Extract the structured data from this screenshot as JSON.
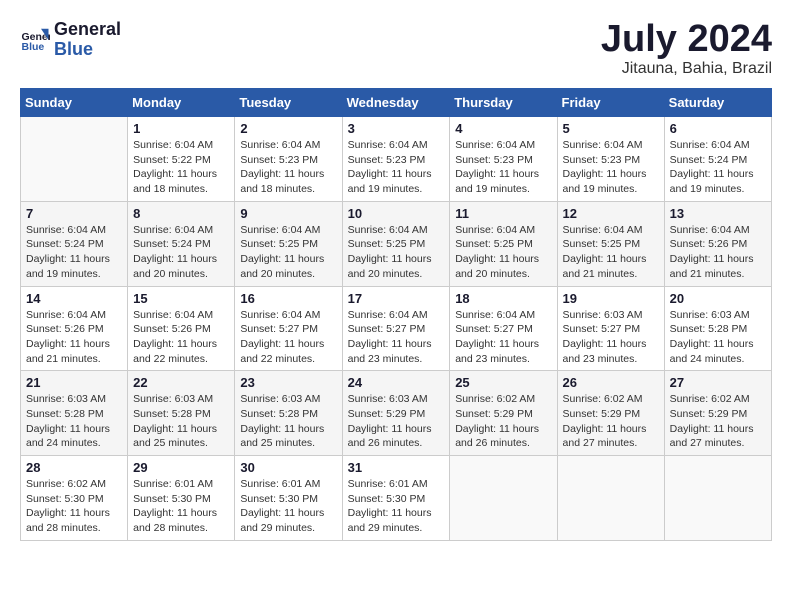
{
  "header": {
    "logo_line1": "General",
    "logo_line2": "Blue",
    "month_title": "July 2024",
    "subtitle": "Jitauna, Bahia, Brazil"
  },
  "days_of_week": [
    "Sunday",
    "Monday",
    "Tuesday",
    "Wednesday",
    "Thursday",
    "Friday",
    "Saturday"
  ],
  "weeks": [
    [
      {
        "day": "",
        "info": ""
      },
      {
        "day": "1",
        "info": "Sunrise: 6:04 AM\nSunset: 5:22 PM\nDaylight: 11 hours\nand 18 minutes."
      },
      {
        "day": "2",
        "info": "Sunrise: 6:04 AM\nSunset: 5:23 PM\nDaylight: 11 hours\nand 18 minutes."
      },
      {
        "day": "3",
        "info": "Sunrise: 6:04 AM\nSunset: 5:23 PM\nDaylight: 11 hours\nand 19 minutes."
      },
      {
        "day": "4",
        "info": "Sunrise: 6:04 AM\nSunset: 5:23 PM\nDaylight: 11 hours\nand 19 minutes."
      },
      {
        "day": "5",
        "info": "Sunrise: 6:04 AM\nSunset: 5:23 PM\nDaylight: 11 hours\nand 19 minutes."
      },
      {
        "day": "6",
        "info": "Sunrise: 6:04 AM\nSunset: 5:24 PM\nDaylight: 11 hours\nand 19 minutes."
      }
    ],
    [
      {
        "day": "7",
        "info": "Sunrise: 6:04 AM\nSunset: 5:24 PM\nDaylight: 11 hours\nand 19 minutes."
      },
      {
        "day": "8",
        "info": "Sunrise: 6:04 AM\nSunset: 5:24 PM\nDaylight: 11 hours\nand 20 minutes."
      },
      {
        "day": "9",
        "info": "Sunrise: 6:04 AM\nSunset: 5:25 PM\nDaylight: 11 hours\nand 20 minutes."
      },
      {
        "day": "10",
        "info": "Sunrise: 6:04 AM\nSunset: 5:25 PM\nDaylight: 11 hours\nand 20 minutes."
      },
      {
        "day": "11",
        "info": "Sunrise: 6:04 AM\nSunset: 5:25 PM\nDaylight: 11 hours\nand 20 minutes."
      },
      {
        "day": "12",
        "info": "Sunrise: 6:04 AM\nSunset: 5:25 PM\nDaylight: 11 hours\nand 21 minutes."
      },
      {
        "day": "13",
        "info": "Sunrise: 6:04 AM\nSunset: 5:26 PM\nDaylight: 11 hours\nand 21 minutes."
      }
    ],
    [
      {
        "day": "14",
        "info": "Sunrise: 6:04 AM\nSunset: 5:26 PM\nDaylight: 11 hours\nand 21 minutes."
      },
      {
        "day": "15",
        "info": "Sunrise: 6:04 AM\nSunset: 5:26 PM\nDaylight: 11 hours\nand 22 minutes."
      },
      {
        "day": "16",
        "info": "Sunrise: 6:04 AM\nSunset: 5:27 PM\nDaylight: 11 hours\nand 22 minutes."
      },
      {
        "day": "17",
        "info": "Sunrise: 6:04 AM\nSunset: 5:27 PM\nDaylight: 11 hours\nand 23 minutes."
      },
      {
        "day": "18",
        "info": "Sunrise: 6:04 AM\nSunset: 5:27 PM\nDaylight: 11 hours\nand 23 minutes."
      },
      {
        "day": "19",
        "info": "Sunrise: 6:03 AM\nSunset: 5:27 PM\nDaylight: 11 hours\nand 23 minutes."
      },
      {
        "day": "20",
        "info": "Sunrise: 6:03 AM\nSunset: 5:28 PM\nDaylight: 11 hours\nand 24 minutes."
      }
    ],
    [
      {
        "day": "21",
        "info": "Sunrise: 6:03 AM\nSunset: 5:28 PM\nDaylight: 11 hours\nand 24 minutes."
      },
      {
        "day": "22",
        "info": "Sunrise: 6:03 AM\nSunset: 5:28 PM\nDaylight: 11 hours\nand 25 minutes."
      },
      {
        "day": "23",
        "info": "Sunrise: 6:03 AM\nSunset: 5:28 PM\nDaylight: 11 hours\nand 25 minutes."
      },
      {
        "day": "24",
        "info": "Sunrise: 6:03 AM\nSunset: 5:29 PM\nDaylight: 11 hours\nand 26 minutes."
      },
      {
        "day": "25",
        "info": "Sunrise: 6:02 AM\nSunset: 5:29 PM\nDaylight: 11 hours\nand 26 minutes."
      },
      {
        "day": "26",
        "info": "Sunrise: 6:02 AM\nSunset: 5:29 PM\nDaylight: 11 hours\nand 27 minutes."
      },
      {
        "day": "27",
        "info": "Sunrise: 6:02 AM\nSunset: 5:29 PM\nDaylight: 11 hours\nand 27 minutes."
      }
    ],
    [
      {
        "day": "28",
        "info": "Sunrise: 6:02 AM\nSunset: 5:30 PM\nDaylight: 11 hours\nand 28 minutes."
      },
      {
        "day": "29",
        "info": "Sunrise: 6:01 AM\nSunset: 5:30 PM\nDaylight: 11 hours\nand 28 minutes."
      },
      {
        "day": "30",
        "info": "Sunrise: 6:01 AM\nSunset: 5:30 PM\nDaylight: 11 hours\nand 29 minutes."
      },
      {
        "day": "31",
        "info": "Sunrise: 6:01 AM\nSunset: 5:30 PM\nDaylight: 11 hours\nand 29 minutes."
      },
      {
        "day": "",
        "info": ""
      },
      {
        "day": "",
        "info": ""
      },
      {
        "day": "",
        "info": ""
      }
    ]
  ]
}
